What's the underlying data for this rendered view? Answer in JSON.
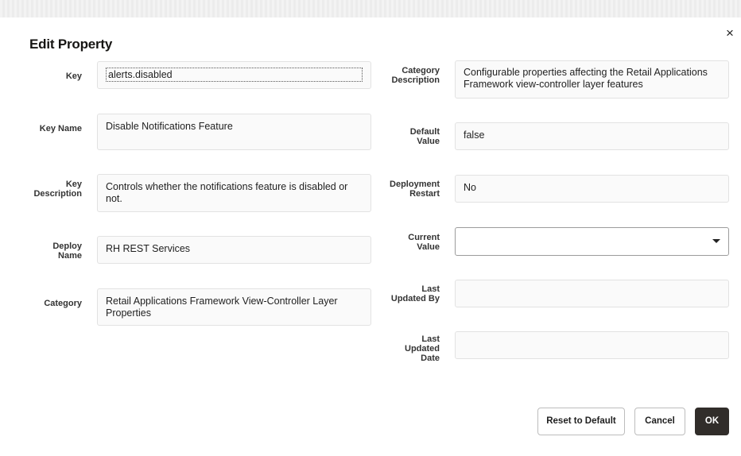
{
  "dialog": {
    "title": "Edit Property",
    "close_icon": "×"
  },
  "left_fields": {
    "key": {
      "label": "Key",
      "value": "alerts.disabled"
    },
    "key_name": {
      "label": "Key Name",
      "value": "Disable Notifications Feature"
    },
    "key_description": {
      "label_line1": "Key",
      "label_line2": "Description",
      "value": "Controls whether the notifications feature is disabled or not."
    },
    "deploy_name": {
      "label_line1": "Deploy",
      "label_line2": "Name",
      "value": "RH REST Services"
    },
    "category": {
      "label": "Category",
      "value": "Retail Applications Framework View-Controller Layer Properties"
    }
  },
  "right_fields": {
    "category_description": {
      "label_line1": "Category",
      "label_line2": "Description",
      "value": "Configurable properties affecting the Retail Applications Framework view-controller layer features"
    },
    "default_value": {
      "label_line1": "Default",
      "label_line2": "Value",
      "value": "false"
    },
    "deployment_restart": {
      "label_line1": "Deployment",
      "label_line2": "Restart",
      "value": "No"
    },
    "current_value": {
      "label_line1": "Current",
      "label_line2": "Value",
      "value": ""
    },
    "last_updated_by": {
      "label_line1": "Last",
      "label_line2": "Updated By",
      "value": ""
    },
    "last_updated_date": {
      "label_line1": "Last",
      "label_line2": "Updated",
      "label_line3": "Date",
      "value": ""
    }
  },
  "footer": {
    "reset_label": "Reset to Default",
    "cancel_label": "Cancel",
    "ok_label": "OK"
  }
}
